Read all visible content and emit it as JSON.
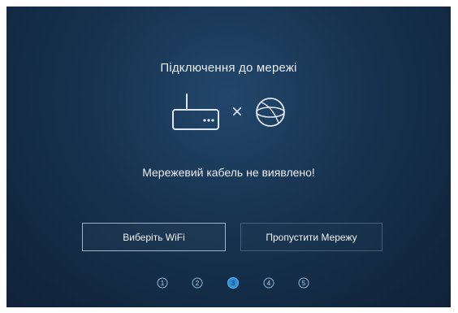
{
  "dialog": {
    "title": "Підключення до мережі",
    "separator": "×",
    "message": "Мережевий кабель не виявлено!"
  },
  "buttons": {
    "select_wifi": "Виберіть WiFi",
    "skip_network": "Пропустити Мережу"
  },
  "stepper": {
    "steps": [
      "1",
      "2",
      "3",
      "4",
      "5"
    ],
    "current": 3
  },
  "icons": {
    "router": "router-icon",
    "globe": "globe-icon"
  },
  "colors": {
    "background": "#17324f",
    "active_step": "#2b8fd6",
    "line": "#4f8cc0"
  }
}
